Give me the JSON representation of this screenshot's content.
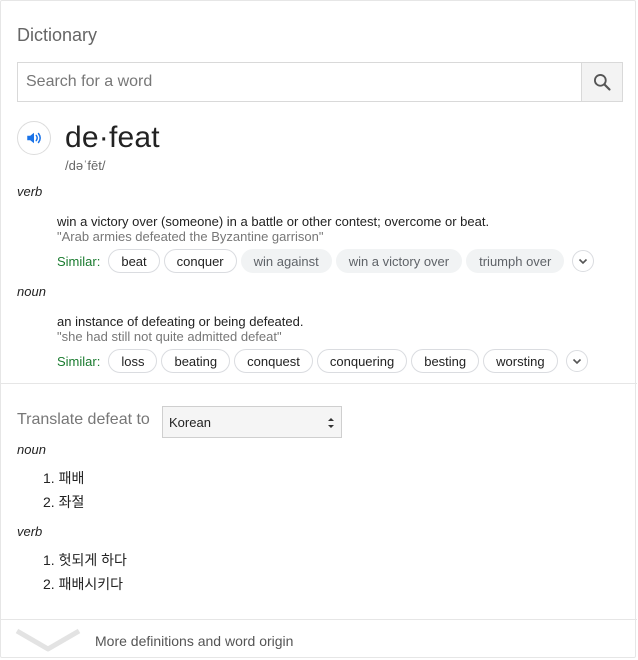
{
  "title": "Dictionary",
  "search": {
    "placeholder": "Search for a word",
    "value": ""
  },
  "entry": {
    "word": "de·feat",
    "phonetic": "/dəˈfēt/",
    "senses": [
      {
        "pos": "verb",
        "definition": "win a victory over (someone) in a battle or other contest; overcome or beat.",
        "example": "\"Arab armies defeated the Byzantine garrison\"",
        "similar_label": "Similar:",
        "similar": [
          {
            "text": "beat",
            "style": "outline"
          },
          {
            "text": "conquer",
            "style": "outline"
          },
          {
            "text": "win against",
            "style": "filled"
          },
          {
            "text": "win a victory over",
            "style": "filled"
          },
          {
            "text": "triumph over",
            "style": "filled"
          }
        ]
      },
      {
        "pos": "noun",
        "definition": "an instance of defeating or being defeated.",
        "example": "\"she had still not quite admitted defeat\"",
        "similar_label": "Similar:",
        "similar": [
          {
            "text": "loss",
            "style": "outline"
          },
          {
            "text": "beating",
            "style": "outline"
          },
          {
            "text": "conquest",
            "style": "outline"
          },
          {
            "text": "conquering",
            "style": "outline"
          },
          {
            "text": "besting",
            "style": "outline"
          },
          {
            "text": "worsting",
            "style": "outline"
          }
        ]
      }
    ]
  },
  "translate": {
    "label": "Translate defeat to",
    "language": "Korean",
    "groups": [
      {
        "pos": "noun",
        "items": [
          "1. 패배",
          "2. 좌절"
        ]
      },
      {
        "pos": "verb",
        "items": [
          "1. 헛되게 하다",
          "2. 패배시키다"
        ]
      }
    ]
  },
  "footer": {
    "more_label": "More definitions and word origin"
  },
  "colors": {
    "similar_label": "#1a7b2f",
    "speaker_icon": "#1a73e8"
  },
  "icons": {
    "search": "search-icon",
    "speaker": "speaker-icon",
    "expand": "chevron-down-icon",
    "more": "chevron-down-icon"
  }
}
